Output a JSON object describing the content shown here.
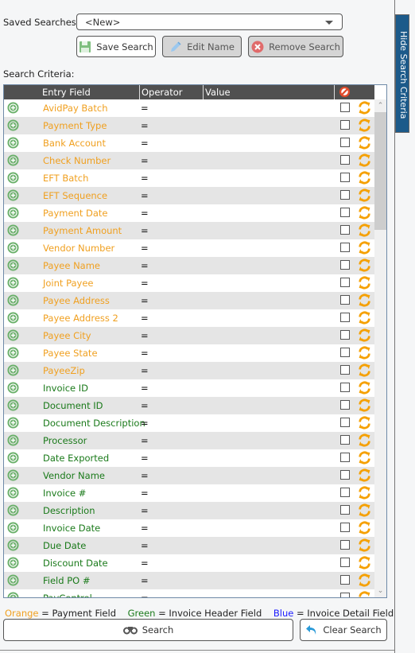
{
  "saved_searches": {
    "label": "Saved Searches:",
    "selected": "<New>"
  },
  "toolbar": {
    "save_label": "Save Search",
    "edit_label": "Edit Name",
    "remove_label": "Remove Search"
  },
  "criteria": {
    "label": "Search Criteria:",
    "columns": [
      "Entry Field",
      "Operator",
      "Value"
    ],
    "rows": [
      {
        "field": "AvidPay Batch",
        "op": "=",
        "type": "payment"
      },
      {
        "field": "Payment Type",
        "op": "=",
        "type": "payment"
      },
      {
        "field": "Bank Account",
        "op": "=",
        "type": "payment"
      },
      {
        "field": "Check Number",
        "op": "=",
        "type": "payment"
      },
      {
        "field": "EFT Batch",
        "op": "=",
        "type": "payment"
      },
      {
        "field": "EFT Sequence",
        "op": "=",
        "type": "payment"
      },
      {
        "field": "Payment Date",
        "op": "=",
        "type": "payment"
      },
      {
        "field": "Payment Amount",
        "op": "=",
        "type": "payment"
      },
      {
        "field": "Vendor Number",
        "op": "=",
        "type": "payment"
      },
      {
        "field": "Payee Name",
        "op": "=",
        "type": "payment"
      },
      {
        "field": "Joint Payee",
        "op": "=",
        "type": "payment"
      },
      {
        "field": "Payee Address",
        "op": "=",
        "type": "payment"
      },
      {
        "field": "Payee Address 2",
        "op": "=",
        "type": "payment"
      },
      {
        "field": "Payee City",
        "op": "=",
        "type": "payment"
      },
      {
        "field": "Payee State",
        "op": "=",
        "type": "payment"
      },
      {
        "field": "PayeeZip",
        "op": "=",
        "type": "payment"
      },
      {
        "field": "Invoice ID",
        "op": "=",
        "type": "header"
      },
      {
        "field": "Document ID",
        "op": "=",
        "type": "header"
      },
      {
        "field": "Document Description",
        "op": "=",
        "type": "header"
      },
      {
        "field": "Processor",
        "op": "=",
        "type": "header"
      },
      {
        "field": "Date Exported",
        "op": "=",
        "type": "header"
      },
      {
        "field": "Vendor Name",
        "op": "=",
        "type": "header"
      },
      {
        "field": "Invoice #",
        "op": "=",
        "type": "header"
      },
      {
        "field": "Description",
        "op": "=",
        "type": "header"
      },
      {
        "field": "Invoice Date",
        "op": "=",
        "type": "header"
      },
      {
        "field": "Due Date",
        "op": "=",
        "type": "header"
      },
      {
        "field": "Discount Date",
        "op": "=",
        "type": "header"
      },
      {
        "field": "Field PO #",
        "op": "=",
        "type": "header"
      },
      {
        "field": "PayControl",
        "op": "=",
        "type": "header"
      }
    ]
  },
  "legend": {
    "orange_word": "Orange",
    "orange_desc": " = Payment Field",
    "green_word": "Green",
    "green_desc": " = Invoice Header Field",
    "blue_word": "Blue",
    "blue_desc": " = Invoice Detail Field"
  },
  "actions": {
    "search_label": "Search",
    "clear_label": "Clear Search"
  },
  "side_tab": {
    "label": "Hide Search Criteria"
  },
  "colors": {
    "payment": "#f0a020",
    "header": "#1a7a1a",
    "detail": "#1a1aff",
    "side_tab": "#1c5a8a",
    "add_icon": "#6ab06a",
    "refresh_icon": "#f5a000"
  }
}
